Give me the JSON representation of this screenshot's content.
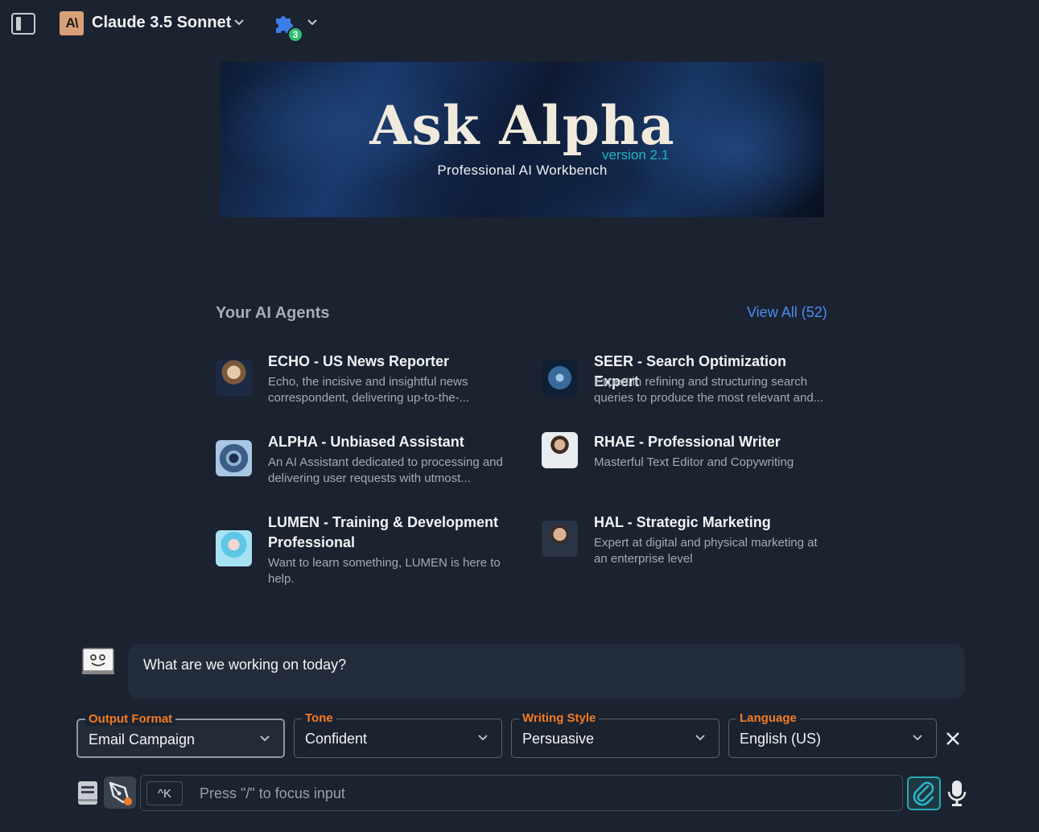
{
  "topbar": {
    "model_logo_text": "A\\",
    "model_name": "Claude 3.5 Sonnet",
    "plugin_count": "3"
  },
  "banner": {
    "title": "Ask Alpha",
    "version": "version 2.1",
    "subtitle": "Professional AI Workbench"
  },
  "agents_section": {
    "heading": "Your AI Agents",
    "view_all": "View All (52)",
    "agents": [
      {
        "name": "ECHO - US News Reporter",
        "desc": "Echo, the incisive and insightful news correspondent, delivering up-to-the-..."
      },
      {
        "name": "SEER - Search Optimization Expert",
        "desc": "Expert in refining and structuring search queries to produce the most relevant and..."
      },
      {
        "name": "ALPHA - Unbiased Assistant",
        "desc": "An AI Assistant dedicated to processing and delivering user requests with utmost..."
      },
      {
        "name": "RHAE - Professional Writer",
        "desc": "Masterful Text Editor and Copywriting"
      },
      {
        "name": "LUMEN - Training & Development Professional",
        "desc": "Want to learn something, LUMEN is here to help."
      },
      {
        "name": "HAL - Strategic Marketing",
        "desc": "Expert at digital and physical marketing at an enterprise level"
      }
    ]
  },
  "chat": {
    "message": "What are we working on today?"
  },
  "options": {
    "output_format": {
      "label": "Output Format",
      "value": "Email Campaign"
    },
    "tone": {
      "label": "Tone",
      "value": "Confident"
    },
    "writing_style": {
      "label": "Writing Style",
      "value": "Persuasive"
    },
    "language": {
      "label": "Language",
      "value": "English (US)"
    }
  },
  "input": {
    "shortcut": "^K",
    "placeholder": "Press \"/\" to focus input"
  },
  "colors": {
    "background": "#1b2230",
    "accent_orange": "#f57c20",
    "link_blue": "#4b8ef0",
    "teal": "#2aa9b6"
  }
}
